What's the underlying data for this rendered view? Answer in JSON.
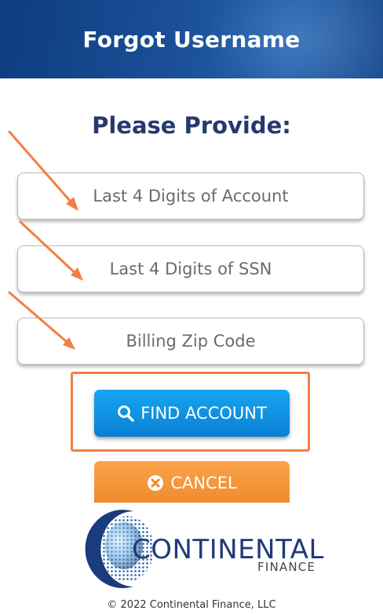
{
  "header": {
    "title": "Forgot Username"
  },
  "main": {
    "heading": "Please Provide:",
    "fields": [
      {
        "placeholder": "Last 4 Digits of Account"
      },
      {
        "placeholder": "Last 4 Digits of SSN"
      },
      {
        "placeholder": "Billing Zip Code"
      }
    ],
    "find_button_label": "FIND ACCOUNT",
    "cancel_button_label": "CANCEL"
  },
  "logo": {
    "name": "CONTINENTAL",
    "subname": "FINANCE"
  },
  "footer": {
    "copyright": "© 2022 Continental Finance, LLC"
  },
  "colors": {
    "header_blue": "#1a4f96",
    "heading_navy": "#243a6e",
    "find_blue": "#0a7fd4",
    "cancel_orange": "#ef8a2c",
    "annotation_orange": "#f47e44"
  },
  "icons": [
    "search-icon",
    "cancel-x-icon",
    "continental-globe-logo"
  ]
}
